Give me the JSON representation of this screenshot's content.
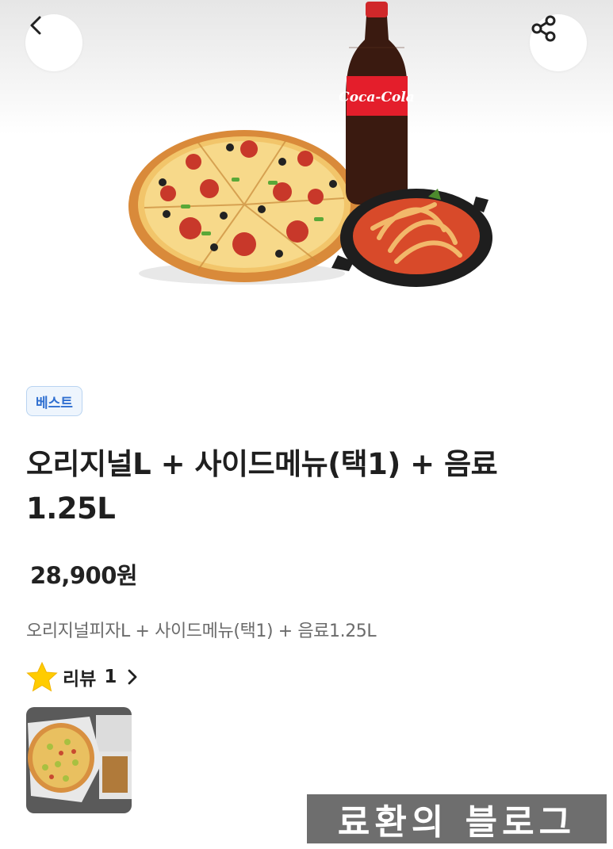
{
  "header": {
    "back_icon": "chevron-left-icon",
    "share_icon": "share-icon"
  },
  "product": {
    "image_alt_brand": "Coca-Cola",
    "badge": "베스트",
    "title_line1": "오리지널L + 사이드메뉴(택1) + 음료",
    "title_line2": "1.25L",
    "price": "28,900원",
    "description": "오리지널피자L + 사이드메뉴(택1) + 음료1.25L"
  },
  "review": {
    "star_icon": "star-icon",
    "label": "리뷰",
    "count": "1",
    "chevron_icon": "chevron-right-icon"
  },
  "watermark": "료환의 블로그",
  "colors": {
    "badge_text": "#2f6fd0",
    "badge_bg": "#eef5fd",
    "star": "#ffcc00",
    "watermark_bg": "#6e6e6e"
  }
}
